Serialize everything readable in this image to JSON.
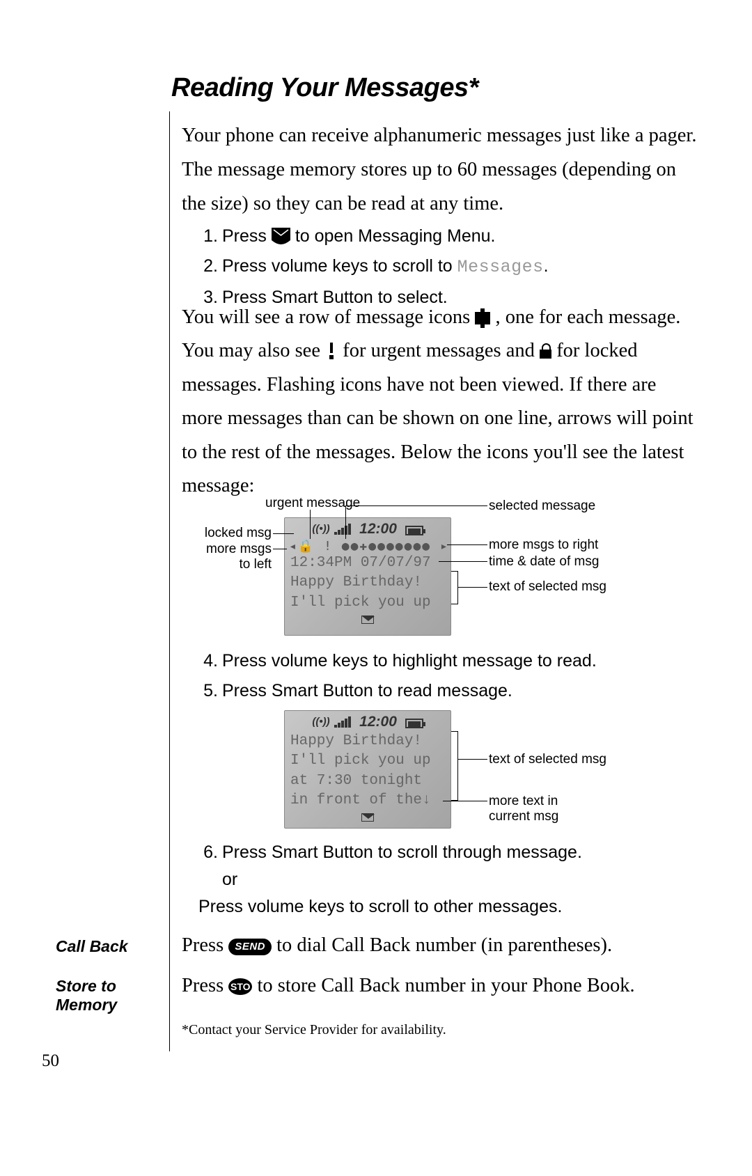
{
  "title": "Reading Your Messages*",
  "intro": "Your phone can receive alphanumeric messages just like a pager. The message memory stores up to 60 messages (depending on the size) so they can be read at any time.",
  "steps_a": {
    "1a": "Press ",
    "1b": " to open Messaging Menu.",
    "2a": "Press volume keys to scroll to ",
    "2_menu": "Messages",
    "2b": ".",
    "3": "Press Smart Button to select."
  },
  "para2_a": "You will see a row of message icons ",
  "para2_b": " , one for each message. You may also see ",
  "para2_c": " for urgent messages and ",
  "para2_d": " for locked messages. Flashing icons have not been viewed. If there are more messages than can be shown on one line, arrows will point to the rest of the messages. Below the icons you'll see the latest message:",
  "screen1": {
    "time": "12:00",
    "row": "◂🔒 ! ●●✚●●●●●●● ▸",
    "line1": "12:34PM 07/07/97",
    "line2": "Happy Birthday!",
    "line3": "I'll pick you up"
  },
  "callouts1": {
    "urgent": "urgent message",
    "locked": "locked msg",
    "more_left": "more msgs to left",
    "selected": "selected message",
    "more_right": "more msgs to right",
    "timedate": "time & date of msg",
    "text": "text of selected msg"
  },
  "steps_b": {
    "4": "Press volume keys to highlight message to read.",
    "5": "Press Smart Button to read message."
  },
  "screen2": {
    "time": "12:00",
    "line1": "Happy Birthday!",
    "line2": "I'll pick you up",
    "line3": "at 7:30 tonight",
    "line4": "in front of the↓"
  },
  "callouts2": {
    "text": "text of selected msg",
    "more": "more text in current msg"
  },
  "steps_c": {
    "6a": "Press Smart Button to scroll through message.",
    "6or": "or",
    "6b": "Press volume keys to scroll to other messages."
  },
  "callback": {
    "label": "Call Back",
    "a": "Press ",
    "btn": "SEND",
    "b": " to dial Call Back number (in parentheses)."
  },
  "store": {
    "label": "Store to Memory",
    "a": "Press ",
    "btn": "STO",
    "b": " to store Call Back number in your Phone Book."
  },
  "footnote": "*Contact your Service Provider for availability.",
  "pagenum": "50"
}
